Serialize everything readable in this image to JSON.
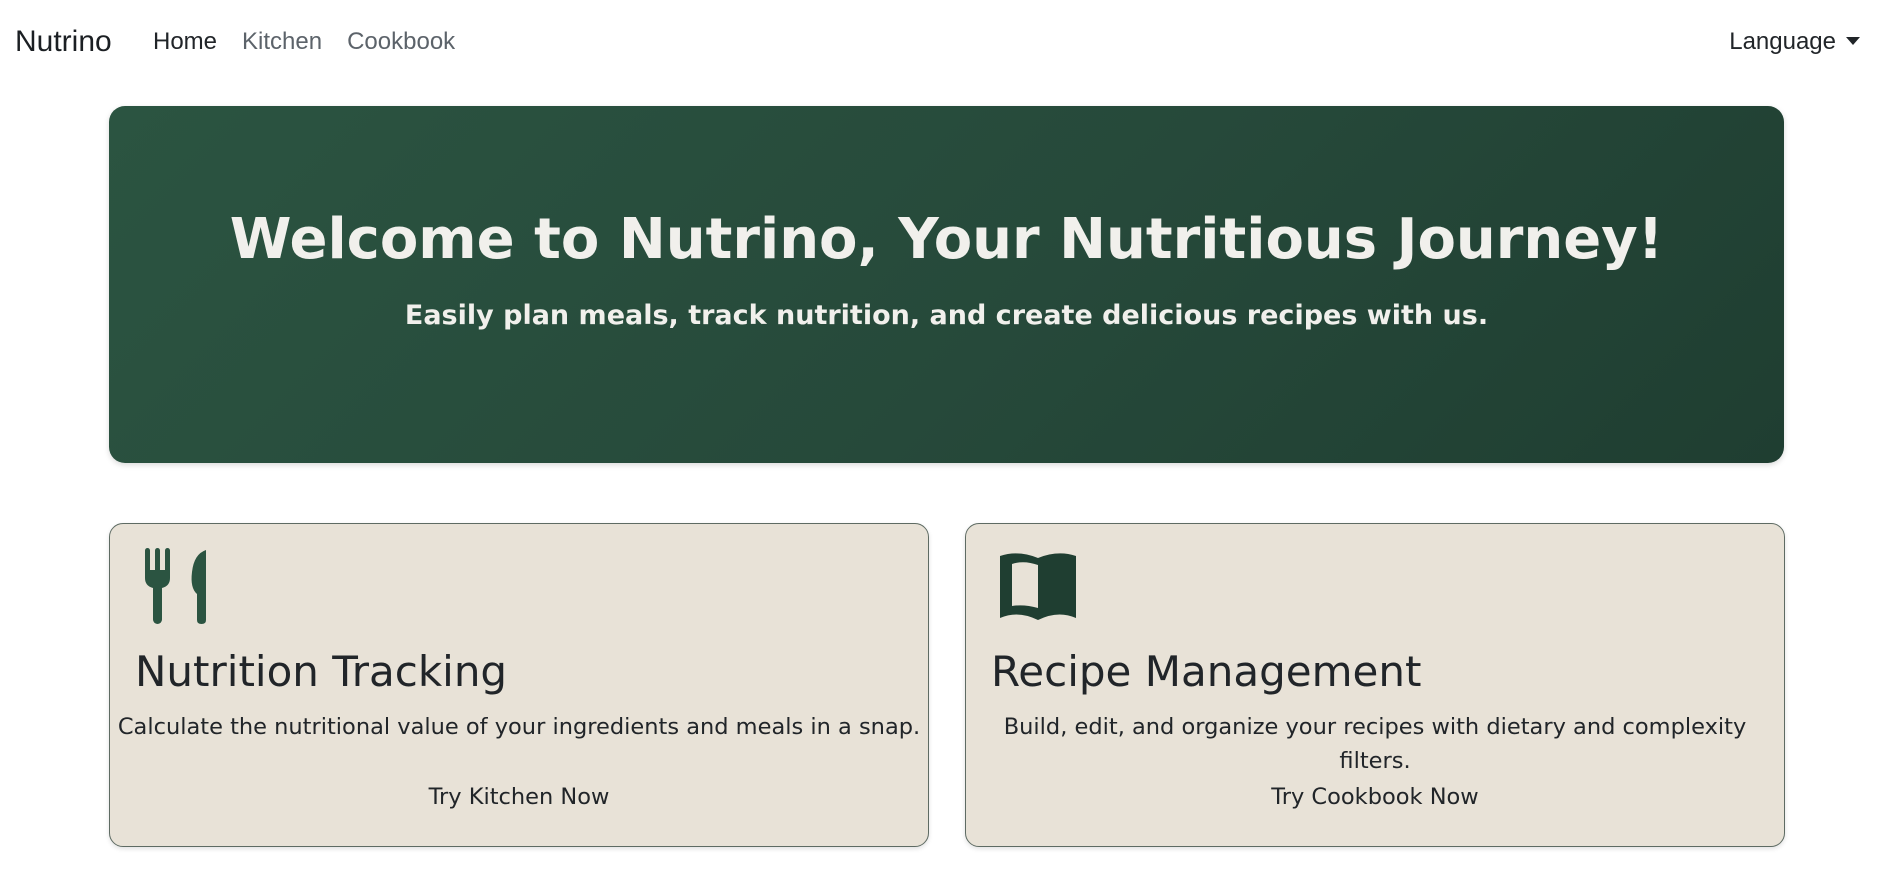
{
  "navbar": {
    "brand": "Nutrino",
    "links": [
      {
        "label": "Home"
      },
      {
        "label": "Kitchen"
      },
      {
        "label": "Cookbook"
      }
    ],
    "language_label": "Language"
  },
  "hero": {
    "title": "Welcome to Nutrino, Your Nutritious Journey!",
    "subtitle": "Easily plan meals, track nutrition, and create delicious recipes with us."
  },
  "features": [
    {
      "icon": "utensils-icon",
      "title": "Nutrition Tracking",
      "description": "Calculate the nutritional value of your ingredients and meals in a snap.",
      "cta": "Try Kitchen Now"
    },
    {
      "icon": "open-book-icon",
      "title": "Recipe Management",
      "description": "Build, edit, and organize your recipes with dietary and complexity filters.",
      "cta": "Try Cookbook Now"
    }
  ],
  "colors": {
    "hero_bg": "#26493a",
    "card_bg": "#e8e2d7",
    "icon_green": "#2b5441",
    "hero_text": "#f1f0ec"
  }
}
